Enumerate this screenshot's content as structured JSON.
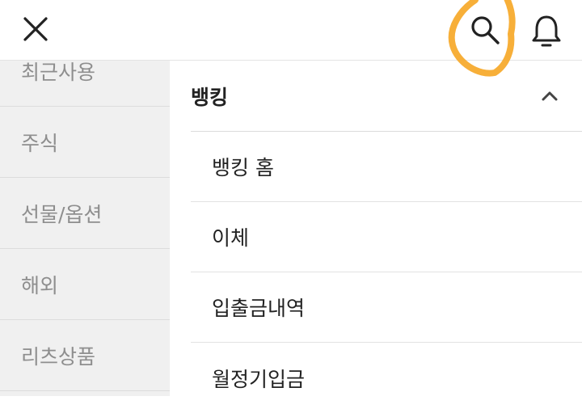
{
  "header": {
    "close_icon": "close-icon",
    "search_icon": "search-icon",
    "bell_icon": "bell-icon",
    "highlight_color": "#F6A623"
  },
  "sidebar": {
    "items": [
      {
        "label": "최근사용"
      },
      {
        "label": "주식"
      },
      {
        "label": "선물/옵션"
      },
      {
        "label": "해외"
      },
      {
        "label": "리츠상품"
      }
    ]
  },
  "main": {
    "section_title": "뱅킹",
    "section_state": "expanded",
    "items": [
      {
        "label": "뱅킹 홈"
      },
      {
        "label": "이체"
      },
      {
        "label": "입출금내역"
      },
      {
        "label": "월정기입금"
      }
    ]
  }
}
